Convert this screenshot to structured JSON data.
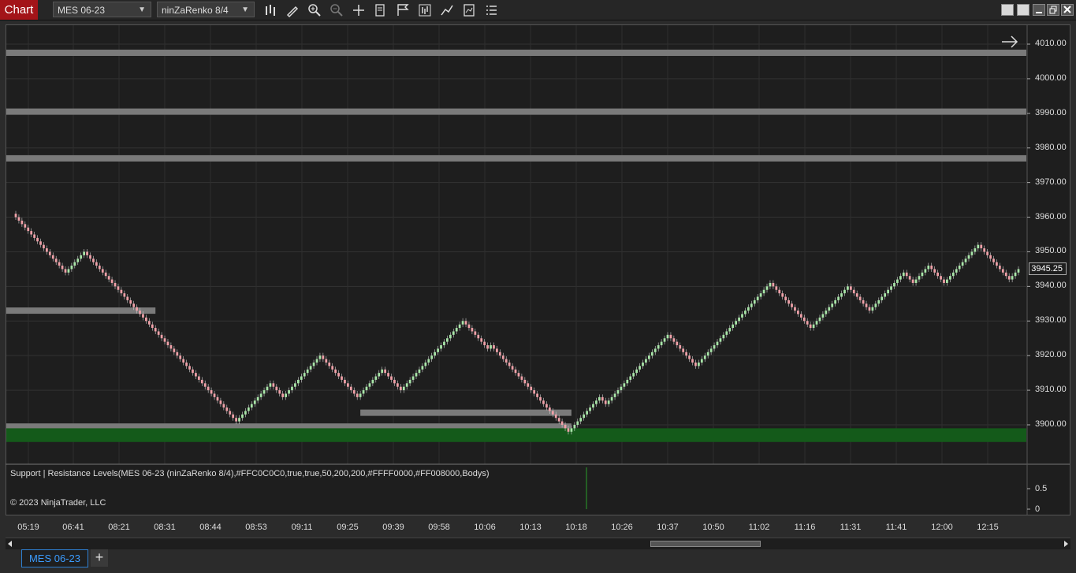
{
  "toolbar": {
    "chart_label": "Chart",
    "instrument": "MES 06-23",
    "bar_type": "ninZaRenko 8/4",
    "icons": [
      "bars-type-icon",
      "pencil-draw-icon",
      "zoom-in-icon",
      "zoom-out-icon",
      "crosshair-icon",
      "properties-icon",
      "chart-trader-icon",
      "indicators-icon",
      "strategies-icon",
      "templates-icon",
      "list-icon"
    ]
  },
  "chart": {
    "price_axis": [
      "4010.00",
      "4000.00",
      "3990.00",
      "3980.00",
      "3970.00",
      "3960.00",
      "3950.00",
      "3940.00",
      "3930.00",
      "3920.00",
      "3910.00",
      "3900.00"
    ],
    "current_price": "3945.25",
    "indicator_label": "Support | Resistance Levels(MES 06-23 (ninZaRenko 8/4),#FFC0C0C0,true,true,50,200,200,#FFFF0000,#FF008000,Bodys)",
    "indicator_axis": [
      "0.5",
      "0"
    ],
    "copyright": "© 2023 NinjaTrader, LLC",
    "time_axis": [
      "05:19",
      "06:41",
      "08:21",
      "08:31",
      "08:44",
      "08:53",
      "09:11",
      "09:25",
      "09:39",
      "09:58",
      "10:06",
      "10:13",
      "10:18",
      "10:26",
      "10:37",
      "10:50",
      "11:02",
      "11:16",
      "11:31",
      "11:41",
      "12:00",
      "12:15"
    ],
    "colors": {
      "up": "#a8e6a8",
      "down": "#f0a0a8",
      "resistance": "#7a7a7a",
      "support": "#145a1a",
      "background": "#1e1e1e"
    }
  },
  "tabs": [
    {
      "label": "MES 06-23"
    }
  ],
  "chart_data": {
    "type": "line",
    "y_range": [
      3890,
      4015
    ],
    "price_path": [
      3961,
      3956,
      3952,
      3950,
      3946,
      3944,
      3950,
      3946,
      3940,
      3933,
      3928,
      3923,
      3917,
      3911,
      3905,
      3901,
      3906,
      3912,
      3908,
      3914,
      3920,
      3916,
      3908,
      3912,
      3916,
      3910,
      3920,
      3928,
      3930,
      3922,
      3923,
      3916,
      3910,
      3903,
      3898,
      3904,
      3908,
      3906,
      3908,
      3915,
      3921,
      3926,
      3920,
      3917,
      3922,
      3926,
      3930,
      3933,
      3939,
      3941,
      3936,
      3930,
      3928,
      3935,
      3940,
      3937,
      3933,
      3939,
      3944,
      3941,
      3941,
      3946,
      3942,
      3941,
      3949,
      3952,
      3947,
      3942,
      3945
    ],
    "resistance_levels": [
      4007.5,
      3990.5,
      3977,
      3933
    ],
    "support_lines": [
      {
        "price": 3903.5,
        "from_bar": 22,
        "to_bar": 34
      },
      {
        "price": 3899.5,
        "from_bar": 0,
        "to_bar": 34
      }
    ],
    "support_zone": [
      3895.5,
      3899.0
    ]
  }
}
